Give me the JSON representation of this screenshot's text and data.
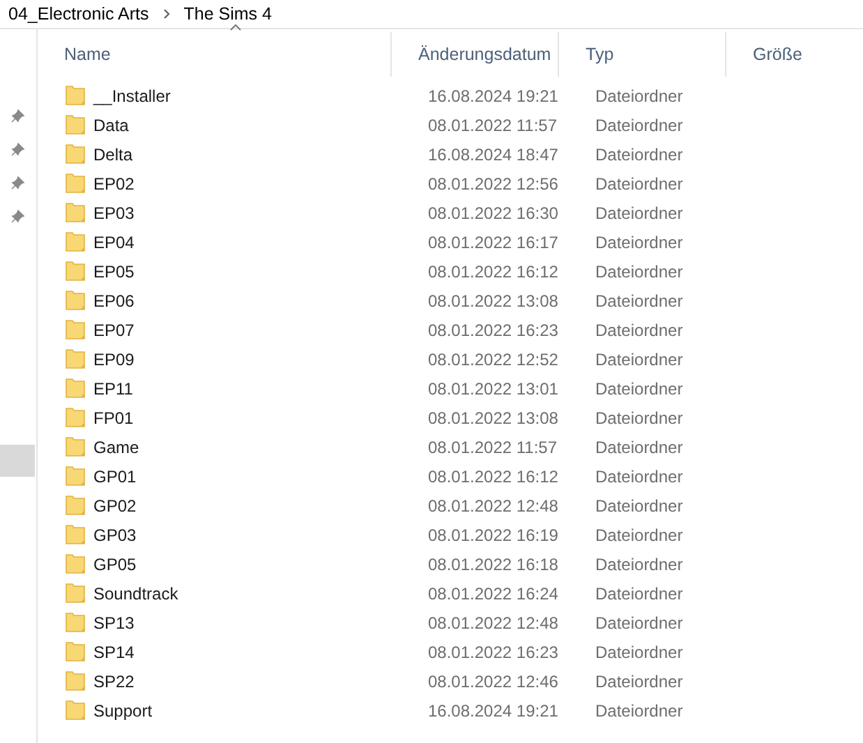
{
  "breadcrumb": [
    "04_Electronic Arts",
    "The Sims 4"
  ],
  "columns": [
    {
      "label": "Name",
      "sorted": true
    },
    {
      "label": "Änderungsdatum",
      "sorted": false
    },
    {
      "label": "Typ",
      "sorted": false
    },
    {
      "label": "Größe",
      "sorted": false
    }
  ],
  "rows": [
    {
      "name": "__Installer",
      "modified": "16.08.2024 19:21",
      "type": "Dateiordner"
    },
    {
      "name": "Data",
      "modified": "08.01.2022 11:57",
      "type": "Dateiordner"
    },
    {
      "name": "Delta",
      "modified": "16.08.2024 18:47",
      "type": "Dateiordner"
    },
    {
      "name": "EP02",
      "modified": "08.01.2022 12:56",
      "type": "Dateiordner"
    },
    {
      "name": "EP03",
      "modified": "08.01.2022 16:30",
      "type": "Dateiordner"
    },
    {
      "name": "EP04",
      "modified": "08.01.2022 16:17",
      "type": "Dateiordner"
    },
    {
      "name": "EP05",
      "modified": "08.01.2022 16:12",
      "type": "Dateiordner"
    },
    {
      "name": "EP06",
      "modified": "08.01.2022 13:08",
      "type": "Dateiordner"
    },
    {
      "name": "EP07",
      "modified": "08.01.2022 16:23",
      "type": "Dateiordner"
    },
    {
      "name": "EP09",
      "modified": "08.01.2022 12:52",
      "type": "Dateiordner"
    },
    {
      "name": "EP11",
      "modified": "08.01.2022 13:01",
      "type": "Dateiordner"
    },
    {
      "name": "FP01",
      "modified": "08.01.2022 13:08",
      "type": "Dateiordner"
    },
    {
      "name": "Game",
      "modified": "08.01.2022 11:57",
      "type": "Dateiordner"
    },
    {
      "name": "GP01",
      "modified": "08.01.2022 16:12",
      "type": "Dateiordner"
    },
    {
      "name": "GP02",
      "modified": "08.01.2022 12:48",
      "type": "Dateiordner"
    },
    {
      "name": "GP03",
      "modified": "08.01.2022 16:19",
      "type": "Dateiordner"
    },
    {
      "name": "GP05",
      "modified": "08.01.2022 16:18",
      "type": "Dateiordner"
    },
    {
      "name": "Soundtrack",
      "modified": "08.01.2022 16:24",
      "type": "Dateiordner"
    },
    {
      "name": "SP13",
      "modified": "08.01.2022 12:48",
      "type": "Dateiordner"
    },
    {
      "name": "SP14",
      "modified": "08.01.2022 16:23",
      "type": "Dateiordner"
    },
    {
      "name": "SP22",
      "modified": "08.01.2022 12:46",
      "type": "Dateiordner"
    },
    {
      "name": "Support",
      "modified": "16.08.2024 19:21",
      "type": "Dateiordner"
    }
  ]
}
